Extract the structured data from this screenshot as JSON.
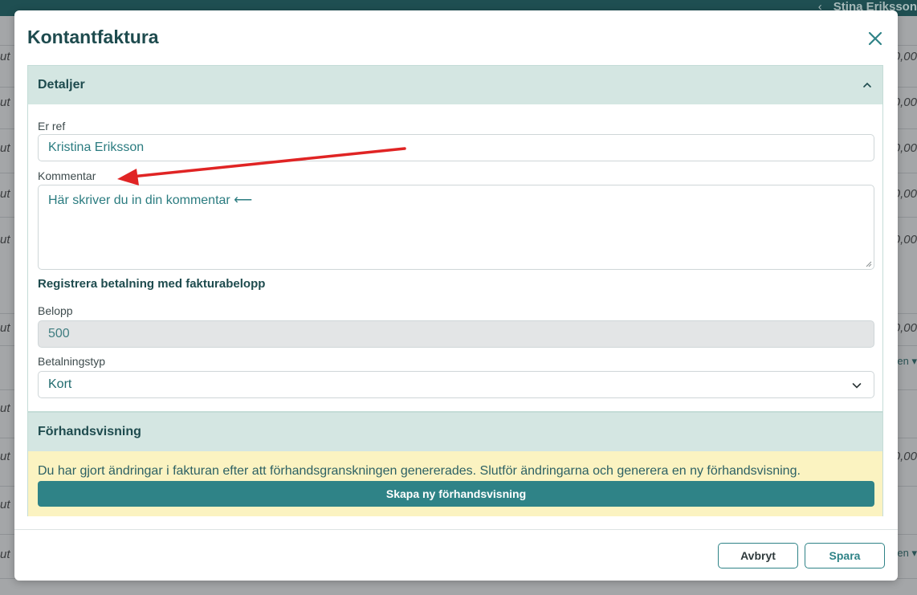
{
  "background": {
    "user_name": "Stina Eriksson",
    "left_fragments": [
      "ut",
      "ut",
      "ut",
      "ut",
      "ut",
      "ut",
      "ut",
      "ut",
      "ut",
      "ut"
    ],
    "right_fragments": [
      "0,00",
      "0,00",
      "0,00",
      "0,00",
      "0,00",
      "0,00",
      "0,00"
    ],
    "link_fragments": [
      "en ▾",
      "en ▾"
    ]
  },
  "modal": {
    "title": "Kontantfaktura",
    "details": {
      "header": "Detaljer",
      "er_ref_label": "Er ref",
      "er_ref_value": "Kristina Eriksson",
      "comment_label": "Kommentar",
      "comment_value": "Här skriver du in din kommentar ⟵",
      "payment_heading": "Registrera betalning med fakturabelopp",
      "amount_label": "Belopp",
      "amount_value": "500",
      "payment_type_label": "Betalningstyp",
      "payment_type_value": "Kort"
    },
    "preview": {
      "header": "Förhandsvisning",
      "notice": "Du har gjort ändringar i fakturan efter att förhandsgranskningen genererades. Slutför ändringarna och generera en ny förhandsvisning.",
      "button_label": "Skapa ny förhandsvisning"
    },
    "footer": {
      "cancel_label": "Avbryt",
      "save_label": "Spara"
    }
  },
  "colors": {
    "accent": "#2f8387",
    "header_bg": "#d4e6e2",
    "notice_bg": "#fbf3c1",
    "annotation_arrow": "#e02424"
  }
}
